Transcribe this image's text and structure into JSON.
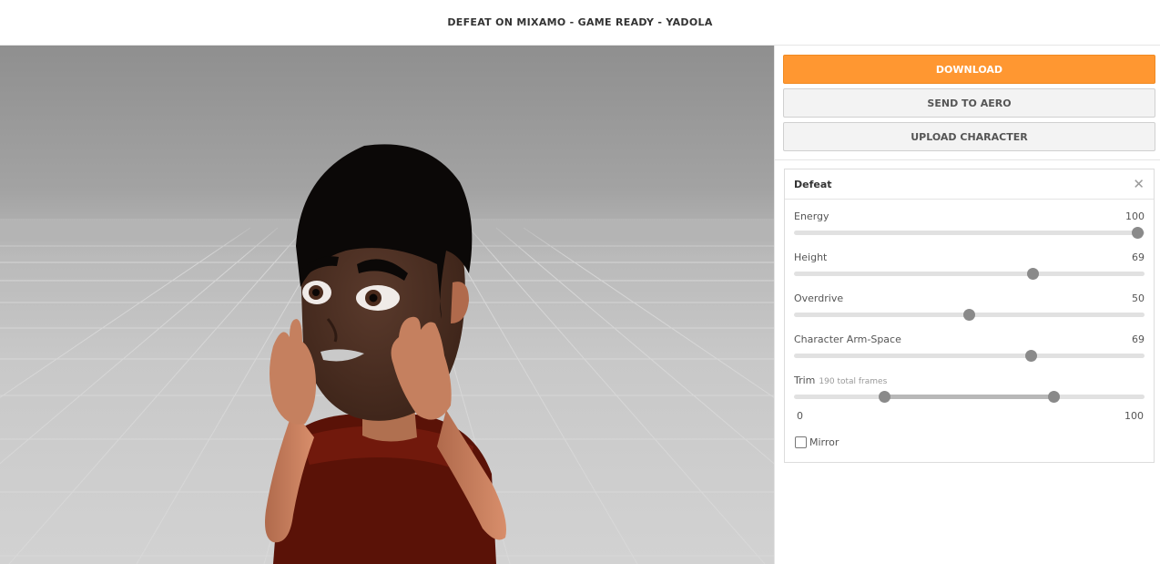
{
  "header": {
    "title": "DEFEAT ON MIXAMO - GAME READY - YADOLA"
  },
  "actions": {
    "download": "DOWNLOAD",
    "send_to_aero": "SEND TO AERO",
    "upload_character": "UPLOAD CHARACTER"
  },
  "animation_panel": {
    "title": "Defeat",
    "close_icon": "close-icon",
    "params": [
      {
        "label": "Energy",
        "value": "100"
      },
      {
        "label": "Height",
        "value": "69"
      },
      {
        "label": "Overdrive",
        "value": "50"
      },
      {
        "label": "Character Arm-Space",
        "value": "69"
      }
    ],
    "trim": {
      "label": "Trim",
      "sub": "190 total frames",
      "min": "0",
      "max": "100",
      "start": 26,
      "end": 74
    },
    "mirror": {
      "label": "Mirror",
      "checked": false
    }
  },
  "colors": {
    "accent": "#ff9731",
    "thumb": "#8a8a8a",
    "track": "#e1e1e1"
  }
}
